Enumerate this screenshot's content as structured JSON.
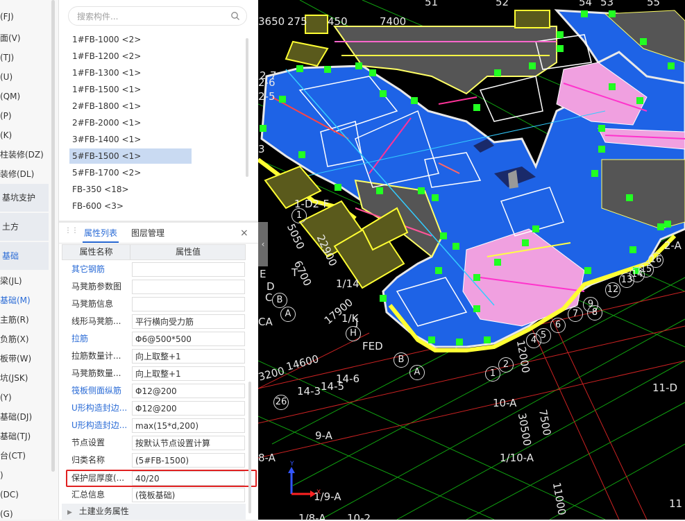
{
  "left_nav": {
    "items": [
      {
        "label": "(FJ)"
      },
      {
        "label": "面(V)"
      },
      {
        "label": "(TJ)"
      },
      {
        "label": "(U)"
      },
      {
        "label": "(QM)"
      },
      {
        "label": "(P)"
      },
      {
        "label": "(K)"
      },
      {
        "label": "柱装修(DZ)"
      },
      {
        "label": "装修(DL)"
      }
    ],
    "sections": [
      {
        "label": "基坑支护"
      },
      {
        "label": "土方"
      },
      {
        "label": "基础"
      }
    ],
    "foundation_items": [
      {
        "label": "梁(JL)"
      },
      {
        "label": "基础(M)"
      },
      {
        "label": "主筋(R)"
      },
      {
        "label": "负筋(X)"
      },
      {
        "label": "板带(W)"
      },
      {
        "label": "坑(JSK)"
      },
      {
        "label": "(Y)"
      },
      {
        "label": "基础(DJ)"
      },
      {
        "label": "基础(TJ)"
      },
      {
        "label": "台(CT)"
      },
      {
        "label": ")"
      },
      {
        "label": "(DC)"
      },
      {
        "label": "(G)"
      }
    ]
  },
  "search": {
    "placeholder": "搜索构件..."
  },
  "component_list": [
    {
      "label": "1#FB-1000 <2>"
    },
    {
      "label": "1#FB-1200 <2>"
    },
    {
      "label": "1#FB-1300 <1>"
    },
    {
      "label": "1#FB-1500 <1>"
    },
    {
      "label": "2#FB-1800 <1>"
    },
    {
      "label": "2#FB-2000 <1>"
    },
    {
      "label": "3#FB-1400 <1>"
    },
    {
      "label": "5#FB-1500 <1>"
    },
    {
      "label": "5#FB-1700 <2>"
    },
    {
      "label": "FB-350 <18>"
    },
    {
      "label": "FB-600 <3>"
    }
  ],
  "property_panel": {
    "tab_properties": "属性列表",
    "tab_layers": "图层管理",
    "close_label": "×",
    "col_name": "属性名称",
    "col_value": "属性值",
    "rows": [
      {
        "name": "其它钢筋",
        "value": ""
      },
      {
        "name": "马凳筋参数图",
        "value": ""
      },
      {
        "name": "马凳筋信息",
        "value": ""
      },
      {
        "name": "线形马凳筋...",
        "value": "平行横向受力筋"
      },
      {
        "name": "拉筋",
        "value": "Φ6@500*500"
      },
      {
        "name": "拉筋数量计...",
        "value": "向上取整+1"
      },
      {
        "name": "马凳筋数量...",
        "value": "向上取整+1"
      },
      {
        "name": "筏板侧面纵筋",
        "value": "Φ12@200"
      },
      {
        "name": "U形构造封边...",
        "value": "Φ12@200"
      },
      {
        "name": "U形构造封边...",
        "value": "max(15*d,200)"
      },
      {
        "name": "节点设置",
        "value": "按默认节点设置计算"
      },
      {
        "name": "归类名称",
        "value": "(5#FB-1500)"
      },
      {
        "name": "保护层厚度(...",
        "value": "40/20"
      },
      {
        "name": "汇总信息",
        "value": "(筏板基础)"
      }
    ],
    "civil_group": "土建业务属性"
  },
  "viewport": {
    "labels": {
      "top1": "3650",
      "top2": "275",
      "top3": "450",
      "top4": "7400",
      "l_2_7": "2-7",
      "l_2_6": "2-6",
      "l_2_5": "2-5",
      "l_3": "3",
      "l_1d2f": "1-D2-F",
      "l_5050": "5050",
      "l_6700": "6700",
      "l_22900": "22900",
      "l_1": "1",
      "l_t": "T",
      "l_e": "E",
      "l_d": "D",
      "l_c": "C",
      "l_b": "B",
      "l_a": "A",
      "l_ca": "CA",
      "l_b2": "B",
      "l_1l14": "1/14",
      "l_17900": "17900",
      "l_1lk": "1/K",
      "l_j": "J",
      "l_h": "H",
      "l_fed": "FED",
      "l_b3": "B",
      "l_a2": "A",
      "l_14600": "14600",
      "l_3200": "3200",
      "l_14_3": "14-3",
      "l_14_5": "14-5",
      "l_14_6": "14-6",
      "l_26": "26",
      "l_1b": "1",
      "l_2b": "2",
      "l_12000": "12000",
      "l_10a": "10-A",
      "l_30500": "30500",
      "l_7500": "7500",
      "l_9a": "9-A",
      "l_8a": "8-A",
      "l_1_10a": "1/10-A",
      "l_1_9a": "1/9-A",
      "l_11000": "11000",
      "l_11d": "11-D",
      "l_11": "11",
      "l_2a": "2-A",
      "l_16": "16",
      "l_15": "15",
      "l_13": "13",
      "l_14": "14",
      "l_12": "12",
      "l_9": "9",
      "l_8": "8",
      "l_7": "7",
      "l_6": "6",
      "l_5": "5",
      "l_4": "4",
      "top_51": "51",
      "top_52": "52",
      "top_53": "53",
      "top_54": "54",
      "top_55": "55",
      "bot_1_8a": "1/8-A",
      "bot_10_2": "10-2",
      "axis_x": "X",
      "axis_y": "Y"
    }
  }
}
